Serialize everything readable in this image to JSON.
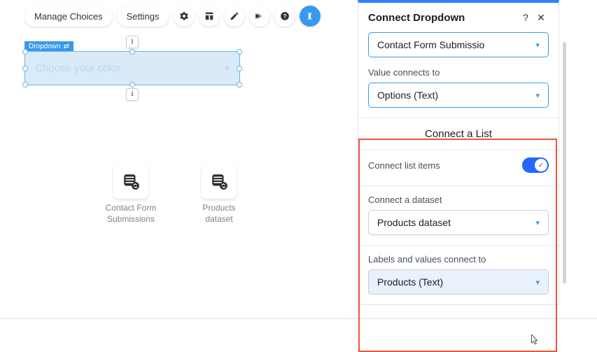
{
  "toolbar": {
    "manage": "Manage Choices",
    "settings": "Settings"
  },
  "canvas": {
    "element_tag": "Dropdown",
    "placeholder": "Choose your color",
    "datasets": [
      {
        "label": "Contact Form Submissions"
      },
      {
        "label": "Products dataset"
      }
    ]
  },
  "panel": {
    "title": "Connect Dropdown",
    "dataset_select": "Contact Form Submissio",
    "value_label": "Value connects to",
    "value_select": "Options (Text)",
    "list_section": "Connect a List",
    "list_toggle_label": "Connect list items",
    "list_toggle_on": true,
    "list_dataset_label": "Connect a dataset",
    "list_dataset_select": "Products dataset",
    "labels_label": "Labels and values connect to",
    "labels_select": "Products (Text)"
  }
}
